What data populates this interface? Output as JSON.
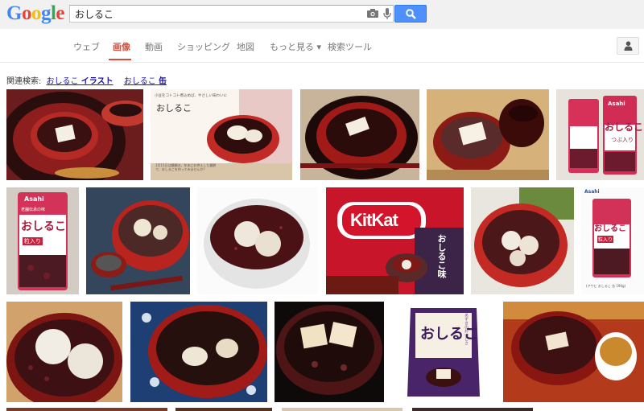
{
  "header": {
    "logo_letters": [
      {
        "ch": "G",
        "color": "#4285f4"
      },
      {
        "ch": "o",
        "color": "#ea4335"
      },
      {
        "ch": "o",
        "color": "#fbbc05"
      },
      {
        "ch": "g",
        "color": "#4285f4"
      },
      {
        "ch": "l",
        "color": "#34a853"
      },
      {
        "ch": "e",
        "color": "#ea4335"
      }
    ],
    "query": "おしるこ",
    "search_icon": "magnifier-icon",
    "camera_icon": "camera-icon",
    "mic_icon": "microphone-icon"
  },
  "nav": {
    "tabs": [
      {
        "label": "ウェブ",
        "active": false
      },
      {
        "label": "画像",
        "active": true
      },
      {
        "label": "動画",
        "active": false
      },
      {
        "label": "ショッピング",
        "active": false
      },
      {
        "label": "地図",
        "active": false
      },
      {
        "label": "もっと見る ▾",
        "active": false
      },
      {
        "label": "検索ツール",
        "active": false
      }
    ],
    "user_icon": "person-icon"
  },
  "related": {
    "prefix": "関連検索:",
    "items": [
      {
        "q": "おしるこ",
        "bold": "イラスト"
      },
      {
        "q": "おしるこ",
        "bold": "缶"
      }
    ]
  },
  "colors": {
    "accent": "#dd4b39",
    "link": "#1a0dab",
    "search_button": "#4d90fe"
  },
  "images": [
    {
      "label": "おしるこ tray",
      "kind": "lacquer-bowl"
    },
    {
      "label": "おしるこ",
      "kind": "illustrated-ad",
      "caption_small": "小豆をコトコト煮込めば、やさしい味わいに",
      "caption_bottom": "1月11日は鏡開き。年末にお供えした鏡餅で、おしるこを作ってみませんか？"
    },
    {
      "label": "bowl",
      "kind": "black-bowl"
    },
    {
      "label": "bowl with lid",
      "kind": "lacquer-lid"
    },
    {
      "label": "cans",
      "kind": "cans",
      "brand": "Asahi",
      "can_text": "おしるこ",
      "sub": "つぶ入り"
    },
    {
      "label": "can",
      "kind": "can-single",
      "brand": "Asahi",
      "can_text": "おしるこ",
      "sub": "粒入り",
      "top": "老舗伝承の味"
    },
    {
      "label": "bowl photo",
      "kind": "red-bowl"
    },
    {
      "label": "white bowl",
      "kind": "white-bowl"
    },
    {
      "label": "KitKat",
      "kind": "kitkat",
      "brand": "KitKat",
      "flavor": "おしるこ味"
    },
    {
      "label": "bowl mochi",
      "kind": "red-bowl-2"
    },
    {
      "label": "can ad",
      "kind": "can-ad",
      "brand": "Asahi",
      "can_text": "おしるこ",
      "sub": "粒入り",
      "note": "(アサヒ おしるこ 缶 190g)"
    },
    {
      "label": "closeup",
      "kind": "closeup"
    },
    {
      "label": "blue cloth",
      "kind": "blue-cloth"
    },
    {
      "label": "black bowl mochi",
      "kind": "dark-bowl"
    },
    {
      "label": "package",
      "kind": "package",
      "title": "おしるこ",
      "small": "あずきのおいしさ"
    },
    {
      "label": "bowl with tea",
      "kind": "tea"
    }
  ]
}
